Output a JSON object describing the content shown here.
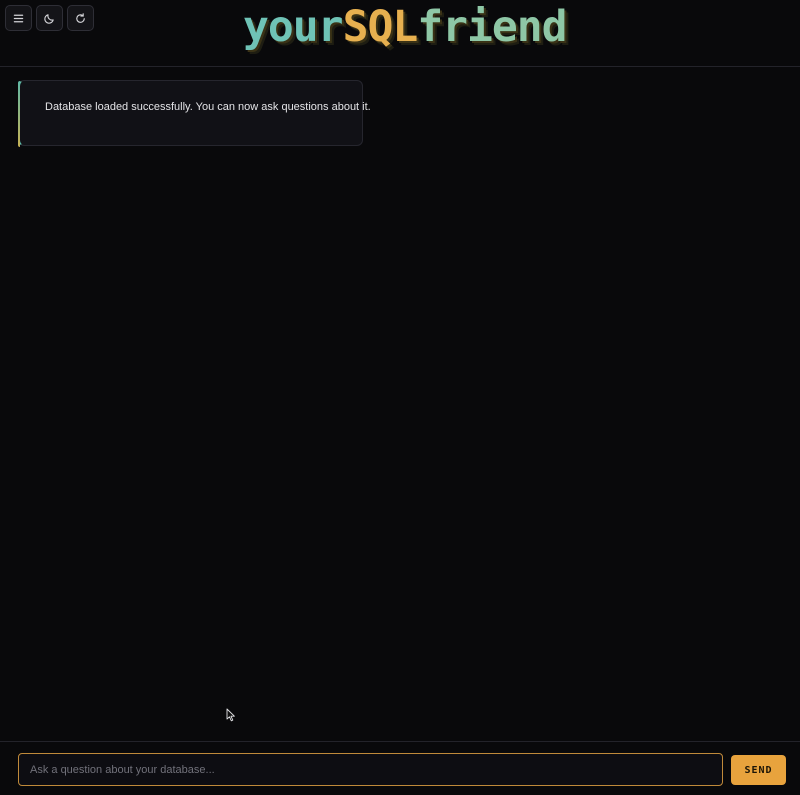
{
  "header": {
    "title_parts": [
      "your",
      "SQL",
      "friend"
    ],
    "buttons": [
      {
        "icon": "menu-icon"
      },
      {
        "icon": "moon-icon"
      },
      {
        "icon": "refresh-icon"
      }
    ]
  },
  "chat": {
    "messages": [
      {
        "role": "system",
        "text": "Database loaded successfully. You can now ask questions about it."
      }
    ]
  },
  "composer": {
    "placeholder": "Ask a question about your database...",
    "value": "",
    "send_label": "SEND"
  },
  "colors": {
    "accent": "#e8a33d",
    "teal": "#6fc3b6",
    "background": "#09090b"
  }
}
